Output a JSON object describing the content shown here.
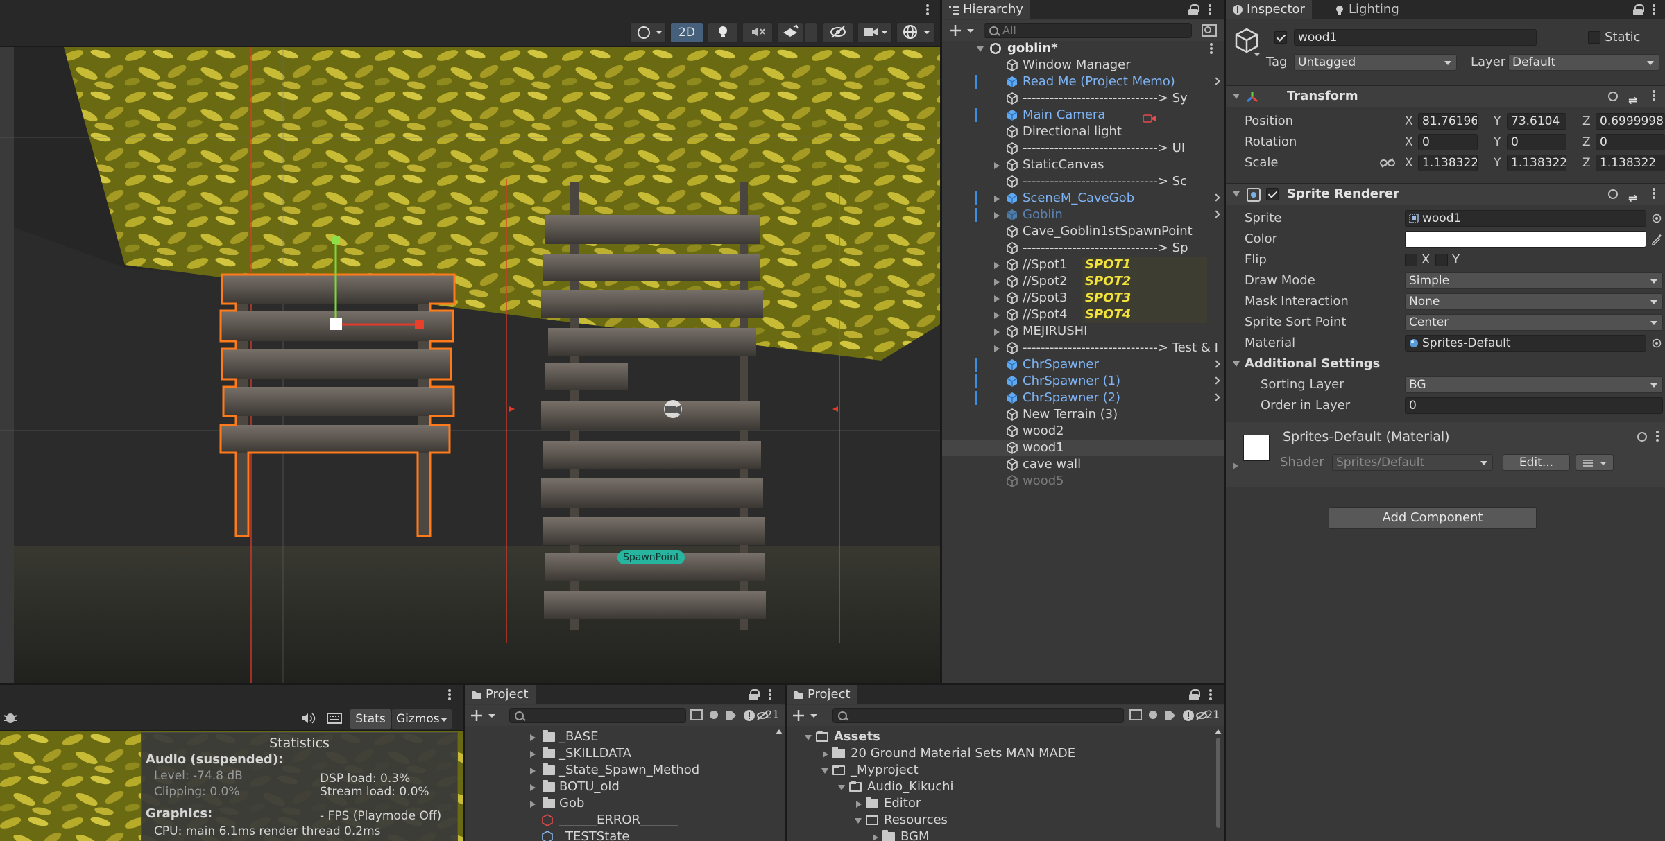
{
  "scene": {
    "toolbar": {
      "mode_2d": "2D"
    },
    "labels": {
      "spawn_point": "SpawnPoint"
    }
  },
  "hierarchy": {
    "tab": "Hierarchy",
    "search_placeholder": "All",
    "root": "goblin*",
    "items": [
      {
        "label": "Window Manager",
        "style": "normal",
        "indent": 1
      },
      {
        "label": "Read Me (Project Memo)",
        "style": "prefab",
        "indent": 1,
        "chevron": true,
        "bar": true
      },
      {
        "label": "------------------------------> Sy",
        "style": "normal",
        "indent": 1
      },
      {
        "label": "Main Camera",
        "style": "prefab",
        "indent": 1,
        "bar": true,
        "camera": true
      },
      {
        "label": "Directional light",
        "style": "normal",
        "indent": 1
      },
      {
        "label": "------------------------------> UI",
        "style": "normal",
        "indent": 1
      },
      {
        "label": "StaticCanvas",
        "style": "normal",
        "indent": 1,
        "arrow": true
      },
      {
        "label": "------------------------------> Sc",
        "style": "normal",
        "indent": 1
      },
      {
        "label": "SceneM_CaveGob",
        "style": "prefab",
        "indent": 1,
        "arrow": true,
        "chevron": true,
        "bar": true
      },
      {
        "label": "Goblin",
        "style": "prefab-disabled",
        "indent": 1,
        "arrow": true,
        "chevron": true,
        "bar": true
      },
      {
        "label": "Cave_Goblin1stSpawnPoint",
        "style": "normal",
        "indent": 1
      },
      {
        "label": "------------------------------> Sp",
        "style": "normal",
        "indent": 1
      },
      {
        "label": "//Spot1",
        "style": "normal",
        "indent": 1,
        "arrow": true,
        "spot": "SPOT1"
      },
      {
        "label": "//Spot2",
        "style": "normal",
        "indent": 1,
        "arrow": true,
        "spot": "SPOT2"
      },
      {
        "label": "//Spot3",
        "style": "normal",
        "indent": 1,
        "arrow": true,
        "spot": "SPOT3"
      },
      {
        "label": "//Spot4",
        "style": "normal",
        "indent": 1,
        "arrow": true,
        "spot": "SPOT4"
      },
      {
        "label": "MEJIRUSHI",
        "style": "normal",
        "indent": 1,
        "arrow": true
      },
      {
        "label": "------------------------------> Test & I",
        "style": "normal",
        "indent": 1,
        "arrow": true
      },
      {
        "label": "ChrSpawner",
        "style": "prefab",
        "indent": 1,
        "chevron": true,
        "bar": true
      },
      {
        "label": "ChrSpawner (1)",
        "style": "prefab",
        "indent": 1,
        "chevron": true,
        "bar": true
      },
      {
        "label": "ChrSpawner (2)",
        "style": "prefab",
        "indent": 1,
        "chevron": true,
        "bar": true
      },
      {
        "label": "New Terrain (3)",
        "style": "normal",
        "indent": 1
      },
      {
        "label": "wood2",
        "style": "normal",
        "indent": 1
      },
      {
        "label": "wood1",
        "style": "normal",
        "indent": 1,
        "selected": true
      },
      {
        "label": "cave wall",
        "style": "normal",
        "indent": 1
      },
      {
        "label": "wood5",
        "style": "disabled",
        "indent": 1
      }
    ]
  },
  "inspector": {
    "tabs": {
      "inspector": "Inspector",
      "lighting": "Lighting"
    },
    "object_name": "wood1",
    "static_label": "Static",
    "tag_label": "Tag",
    "tag_value": "Untagged",
    "layer_label": "Layer",
    "layer_value": "Default",
    "transform": {
      "title": "Transform",
      "position_label": "Position",
      "rotation_label": "Rotation",
      "scale_label": "Scale",
      "x": "X",
      "y": "Y",
      "z": "Z",
      "position": {
        "x": "81.76196",
        "y": "73.6104",
        "z": "0.6999998"
      },
      "rotation": {
        "x": "0",
        "y": "0",
        "z": "0"
      },
      "scale": {
        "x": "1.138322",
        "y": "1.138322",
        "z": "1.138322"
      }
    },
    "sprite_renderer": {
      "title": "Sprite Renderer",
      "sprite_label": "Sprite",
      "sprite_value": "wood1",
      "color_label": "Color",
      "color_value": "#ffffff",
      "flip_label": "Flip",
      "flip_x": "X",
      "flip_y": "Y",
      "draw_mode_label": "Draw Mode",
      "draw_mode_value": "Simple",
      "mask_label": "Mask Interaction",
      "mask_value": "None",
      "sort_point_label": "Sprite Sort Point",
      "sort_point_value": "Center",
      "material_label": "Material",
      "material_value": "Sprites-Default",
      "additional_label": "Additional Settings",
      "sorting_layer_label": "Sorting Layer",
      "sorting_layer_value": "BG",
      "order_label": "Order in Layer",
      "order_value": "0"
    },
    "material": {
      "title": "Sprites-Default (Material)",
      "shader_label": "Shader",
      "shader_value": "Sprites/Default",
      "edit_label": "Edit..."
    },
    "add_component": "Add Component"
  },
  "game": {
    "stats_label": "Stats",
    "gizmos_label": "Gizmos",
    "statistics": {
      "title": "Statistics",
      "audio_header": "Audio (suspended):",
      "level": "Level: -74.8 dB",
      "clipping": "Clipping: 0.0%",
      "dsp": "DSP load: 0.3%",
      "stream": "Stream load: 0.0%",
      "graphics_header": "Graphics:",
      "fps": "- FPS (Playmode Off)",
      "cpu": "CPU: main 6.1ms  render thread 0.2ms"
    }
  },
  "project1": {
    "tab": "Project",
    "badge": "21",
    "items": [
      {
        "label": "_BASE",
        "type": "folder"
      },
      {
        "label": "_SKILLDATA",
        "type": "folder"
      },
      {
        "label": "_State_Spawn_Method",
        "type": "folder"
      },
      {
        "label": "BOTU_old",
        "type": "folder"
      },
      {
        "label": "Gob",
        "type": "folder"
      },
      {
        "label": "______ERROR______",
        "type": "error"
      },
      {
        "label": "_TESTState",
        "type": "asset"
      }
    ]
  },
  "project2": {
    "tab": "Project",
    "badge": "21",
    "items": [
      {
        "label": "Assets",
        "type": "folder-open",
        "indent": 0,
        "bold": true
      },
      {
        "label": "20 Ground Material Sets MAN MADE",
        "type": "folder",
        "indent": 1
      },
      {
        "label": "_Myproject",
        "type": "folder-open",
        "indent": 1
      },
      {
        "label": "Audio_Kikuchi",
        "type": "folder-open",
        "indent": 2
      },
      {
        "label": "Editor",
        "type": "folder",
        "indent": 3
      },
      {
        "label": "Resources",
        "type": "folder-open",
        "indent": 3
      },
      {
        "label": "BGM",
        "type": "folder",
        "indent": 4
      }
    ]
  }
}
